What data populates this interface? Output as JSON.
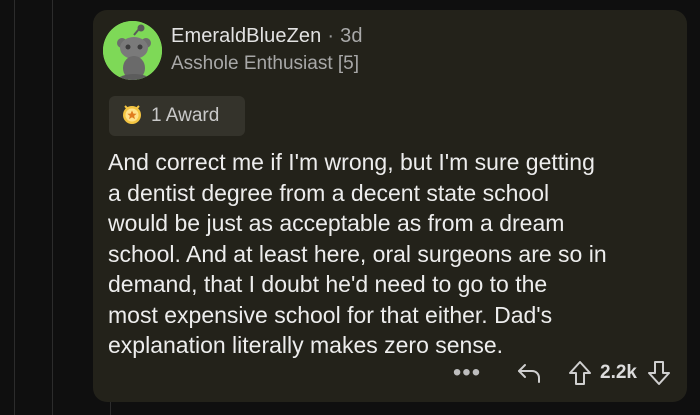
{
  "comment": {
    "author": "EmeraldBlueZen",
    "separator": "·",
    "age": "3d",
    "flair": "Asshole Enthusiast [5]",
    "award_label": "1 Award",
    "body_lines": [
      "And correct me if I'm wrong, but I'm sure getting",
      "a dentist degree from a decent state school",
      "would be just as acceptable as from a dream",
      "school. And at least here, oral surgeons are so in",
      "demand, that I doubt he'd need to go to the",
      "most expensive school for that either. Dad's",
      "explanation literally makes zero sense."
    ],
    "more_label": "•••",
    "vote_count": "2.2k"
  },
  "icons": {
    "avatar": "snoo-avatar-icon",
    "award": "award-icon",
    "reply": "reply-icon",
    "upvote": "upvote-icon",
    "downvote": "downvote-icon"
  },
  "colors": {
    "card_bg": "#23221a",
    "avatar_bg": "#7ed957",
    "award_chip_bg": "#34332b"
  }
}
